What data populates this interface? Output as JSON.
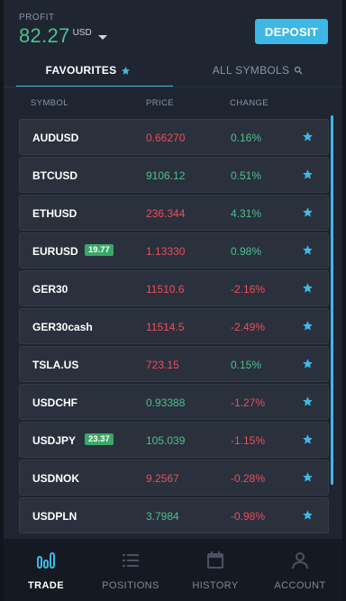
{
  "header": {
    "profit_label": "PROFIT",
    "profit_value": "82.27",
    "profit_currency": "USD",
    "deposit_label": "DEPOSIT"
  },
  "tabs": [
    {
      "label": "FAVOURITES",
      "icon": "star-icon",
      "active": true
    },
    {
      "label": "ALL SYMBOLS",
      "icon": "search-icon",
      "active": false
    }
  ],
  "columns": {
    "symbol": "SYMBOL",
    "price": "PRICE",
    "change": "CHANGE"
  },
  "rows": [
    {
      "symbol": "AUDUSD",
      "badge": "",
      "price": "0.66270",
      "price_dir": "down",
      "change": "0.16%",
      "change_dir": "up"
    },
    {
      "symbol": "BTCUSD",
      "badge": "",
      "price": "9106.12",
      "price_dir": "up",
      "change": "0.51%",
      "change_dir": "up"
    },
    {
      "symbol": "ETHUSD",
      "badge": "",
      "price": "236.344",
      "price_dir": "down",
      "change": "4.31%",
      "change_dir": "up"
    },
    {
      "symbol": "EURUSD",
      "badge": "19.77",
      "price": "1.13330",
      "price_dir": "down",
      "change": "0.98%",
      "change_dir": "up"
    },
    {
      "symbol": "GER30",
      "badge": "",
      "price": "11510.6",
      "price_dir": "down",
      "change": "-2.16%",
      "change_dir": "down"
    },
    {
      "symbol": "GER30cash",
      "badge": "",
      "price": "11514.5",
      "price_dir": "down",
      "change": "-2.49%",
      "change_dir": "down"
    },
    {
      "symbol": "TSLA.US",
      "badge": "",
      "price": "723.15",
      "price_dir": "down",
      "change": "0.15%",
      "change_dir": "up"
    },
    {
      "symbol": "USDCHF",
      "badge": "",
      "price": "0.93388",
      "price_dir": "up",
      "change": "-1.27%",
      "change_dir": "down"
    },
    {
      "symbol": "USDJPY",
      "badge": "23.37",
      "price": "105.039",
      "price_dir": "up",
      "change": "-1.15%",
      "change_dir": "down"
    },
    {
      "symbol": "USDNOK",
      "badge": "",
      "price": "9.2567",
      "price_dir": "down",
      "change": "-0.28%",
      "change_dir": "down"
    },
    {
      "symbol": "USDPLN",
      "badge": "",
      "price": "3.7984",
      "price_dir": "up",
      "change": "-0.98%",
      "change_dir": "down"
    }
  ],
  "nav": [
    {
      "label": "TRADE",
      "icon": "chart-bars-icon",
      "active": true
    },
    {
      "label": "POSITIONS",
      "icon": "list-icon",
      "active": false
    },
    {
      "label": "HISTORY",
      "icon": "calendar-icon",
      "active": false
    },
    {
      "label": "ACCOUNT",
      "icon": "user-icon",
      "active": false
    }
  ],
  "colors": {
    "accent": "#3db8e6",
    "up": "#4fc08d",
    "down": "#e8505b",
    "badge": "#3aa867"
  }
}
